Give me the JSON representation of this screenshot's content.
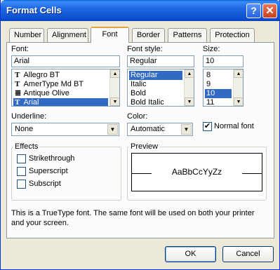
{
  "window": {
    "title": "Format Cells",
    "help_glyph": "?",
    "close_glyph": "✕"
  },
  "tabs": [
    "Number",
    "Alignment",
    "Font",
    "Border",
    "Patterns",
    "Protection"
  ],
  "font": {
    "label": "Font:",
    "value": "Arial",
    "items": [
      {
        "label": "Allegro BT",
        "icon": "truetype-icon"
      },
      {
        "label": "AmerType Md BT",
        "icon": "truetype-icon"
      },
      {
        "label": "Antique Olive",
        "icon": "printer-font-icon"
      },
      {
        "label": "Arial",
        "icon": "truetype-icon",
        "selected": true
      }
    ]
  },
  "font_style": {
    "label": "Font style:",
    "value": "Regular",
    "items": [
      "Regular",
      "Italic",
      "Bold",
      "Bold Italic"
    ],
    "selected": "Regular"
  },
  "size": {
    "label": "Size:",
    "value": "10",
    "items": [
      "8",
      "9",
      "10",
      "11"
    ],
    "selected": "10"
  },
  "underline": {
    "label": "Underline:",
    "value": "None"
  },
  "color": {
    "label": "Color:",
    "value": "Automatic"
  },
  "normal_font": {
    "label": "Normal font",
    "checked": true
  },
  "effects": {
    "title": "Effects",
    "items": [
      {
        "label": "Strikethrough",
        "checked": false
      },
      {
        "label": "Superscript",
        "checked": false
      },
      {
        "label": "Subscript",
        "checked": false
      }
    ]
  },
  "preview": {
    "title": "Preview",
    "sample": "AaBbCcYyZz"
  },
  "description": "This is a TrueType font.  The same font will be used on both your printer and your screen.",
  "buttons": {
    "ok": "OK",
    "cancel": "Cancel"
  },
  "colors": {
    "accent": "#316ac5",
    "title_bar": "#0d4fd0",
    "dialog_bg": "#ece9d8"
  }
}
